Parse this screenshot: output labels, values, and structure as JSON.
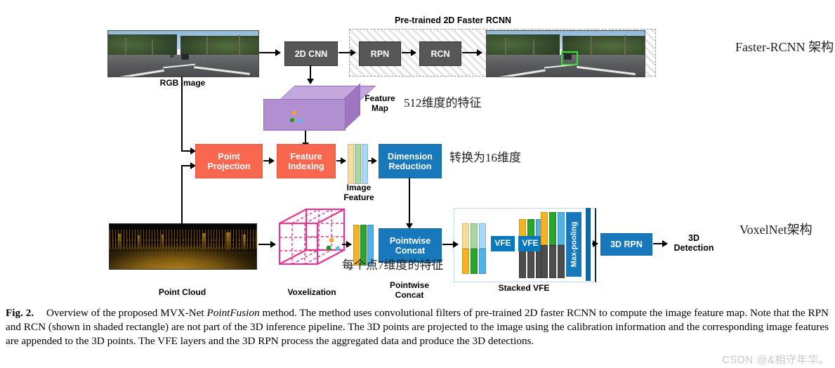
{
  "figure": {
    "section_titles": {
      "pretrained": "Pre-trained 2D Faster RCNN"
    },
    "boxes": {
      "cnn2d": "2D CNN",
      "rpn": "RPN",
      "rcn": "RCN",
      "point_projection": "Point\nProjection",
      "feature_indexing": "Feature\nIndexing",
      "dimension_reduction": "Dimension\nReduction",
      "pointwise_concat": "Pointwise\nConcat",
      "vfe1": "VFE",
      "vfe2": "VFE",
      "maxpooling": "Max-pooling",
      "rpn3d": "3D RPN"
    },
    "labels": {
      "rgb_image": "RGB Image",
      "feature_map": "Feature\nMap",
      "image_feature": "Image\nFeature",
      "point_cloud": "Point Cloud",
      "voxelization": "Voxelization",
      "pointwise_concat_label": "Pointwise\nConcat",
      "stacked_vfe": "Stacked VFE",
      "detection_3d": "3D\nDetection"
    },
    "annotations_cn": {
      "feature_512": "512维度的特征",
      "convert_16": "转换为16维度",
      "per_point_7": "每个点7维度的特征",
      "faster_rcnn_arch": "Faster-RCNN 架构",
      "voxelnet_arch": "VoxelNet架构"
    },
    "caption": {
      "number": "Fig. 2.",
      "text_a": "Overview of the proposed MVX-Net ",
      "italic": "PointFusion",
      "text_b": " method. The method uses convolutional filters of pre-trained 2D faster RCNN to compute the image feature map. Note that the RPN and RCN (shown in shaded rectangle) are not part of the 3D inference pipeline. The 3D points are projected to the image using the calibration information and the corresponding image features are appended to the 3D points. The VFE layers and the 3D RPN process the aggregated data and produce the 3D detections."
    },
    "watermark": "CSDN @&相守年华。",
    "colors": {
      "gray_box": "#575757",
      "orange_box": "#f9674f",
      "blue_box": "#1878bc",
      "feature_map_purple": "#b18fd0",
      "voxel_pink": "#e8368f",
      "strip_yellow": "#f5b324",
      "strip_green": "#2aa72a",
      "strip_blue": "#4fb3e8",
      "strip_light_yellow": "#f6dc9a",
      "strip_light_green": "#a8d7a2",
      "strip_light_blue": "#a9d9f4",
      "strip_dark_gray": "#4d4d4d",
      "bbox_green": "#35e035"
    }
  }
}
